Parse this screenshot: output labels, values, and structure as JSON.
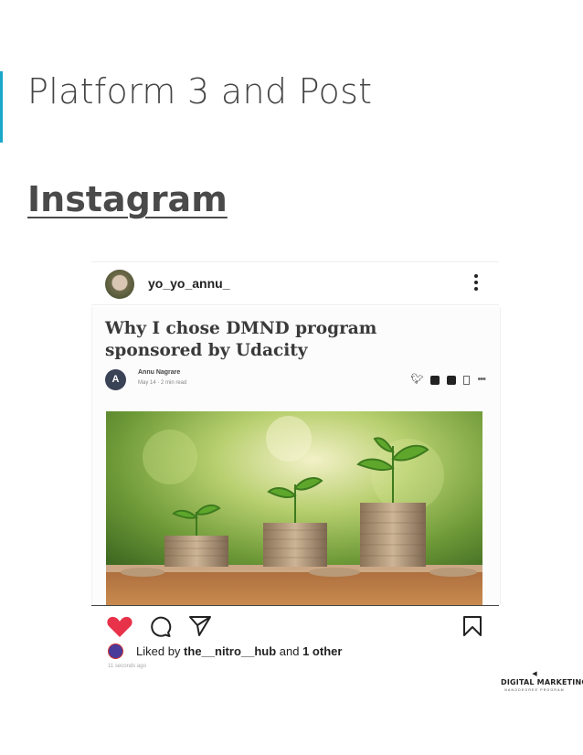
{
  "slide": {
    "title": "Platform 3 and Post",
    "section_heading": "Instagram",
    "accent_color": "#1aa7c9"
  },
  "post": {
    "username": "yo_yo_annu_",
    "header_menu_icon": "more-vertical-icon",
    "article": {
      "title": "Why I chose DMND program sponsored by Udacity",
      "author_initial": "A",
      "author_name": "Annu Nagrare",
      "author_meta": "May 14 · 2 min read",
      "share_icons": [
        "twitter-icon",
        "linkedin-icon",
        "facebook-icon",
        "bookmark-icon",
        "more-horizontal-icon"
      ],
      "image_subject": "growing-plant-coins-image"
    },
    "actions": {
      "like_icon": "heart-icon",
      "liked": true,
      "like_color": "#e8324a",
      "comment_icon": "comment-icon",
      "share_icon": "send-icon",
      "save_icon": "bookmark-icon"
    },
    "likes": {
      "prefix": "Liked by ",
      "user": "the__nitro__hub",
      "middle": " and ",
      "others": "1 other"
    },
    "timestamp": "11 seconds ago"
  },
  "branding": {
    "name": "DIGITAL MARKETING",
    "subtitle": "NANODEGREE PROGRAM"
  }
}
